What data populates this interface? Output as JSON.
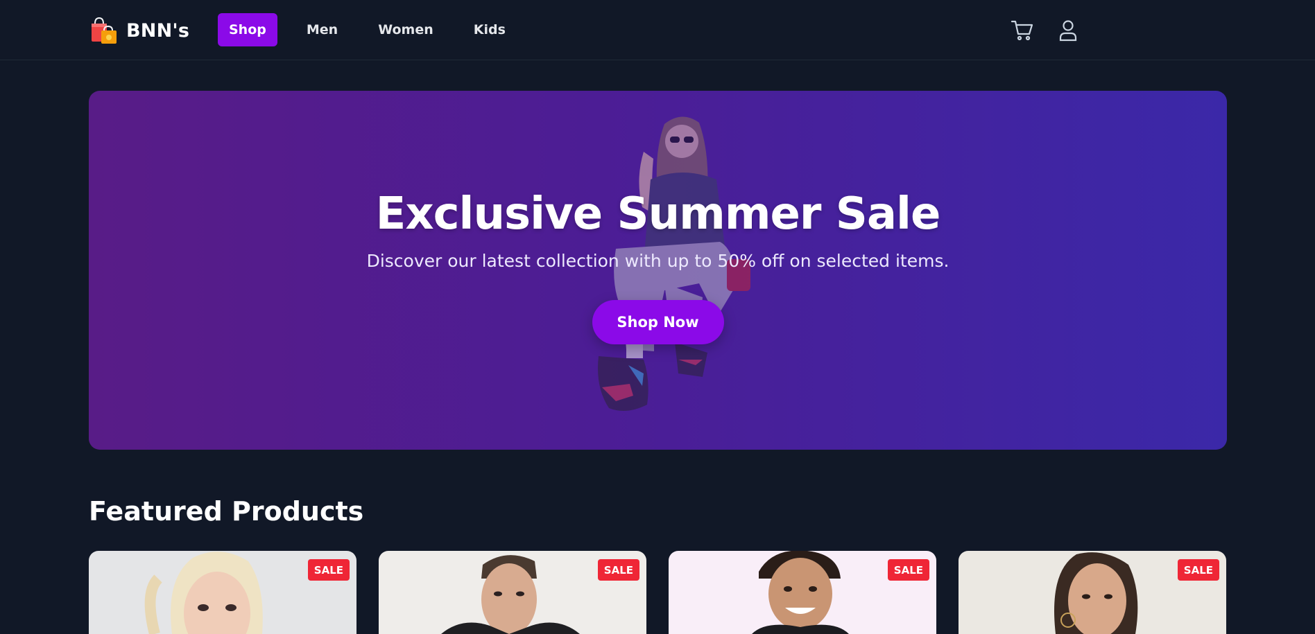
{
  "brand": {
    "name": "BNN's",
    "logo_icon": "shopping-bags-icon"
  },
  "nav": {
    "items": [
      {
        "label": "Shop",
        "active": true
      },
      {
        "label": "Men",
        "active": false
      },
      {
        "label": "Women",
        "active": false
      },
      {
        "label": "Kids",
        "active": false
      }
    ]
  },
  "header_icons": {
    "cart": "cart-icon",
    "account": "user-icon"
  },
  "hero": {
    "title": "Exclusive Summer Sale",
    "subtitle": "Discover our latest collection with up to 50% off on selected items.",
    "cta_label": "Shop Now"
  },
  "featured": {
    "title": "Featured Products",
    "products": [
      {
        "badge": "SALE"
      },
      {
        "badge": "SALE"
      },
      {
        "badge": "SALE"
      },
      {
        "badge": "SALE"
      }
    ]
  },
  "colors": {
    "background": "#111827",
    "accent": "#8b0ae8",
    "hero_gradient_start": "#581c87",
    "hero_gradient_end": "#3b28a8",
    "sale_badge": "#ef2636"
  }
}
